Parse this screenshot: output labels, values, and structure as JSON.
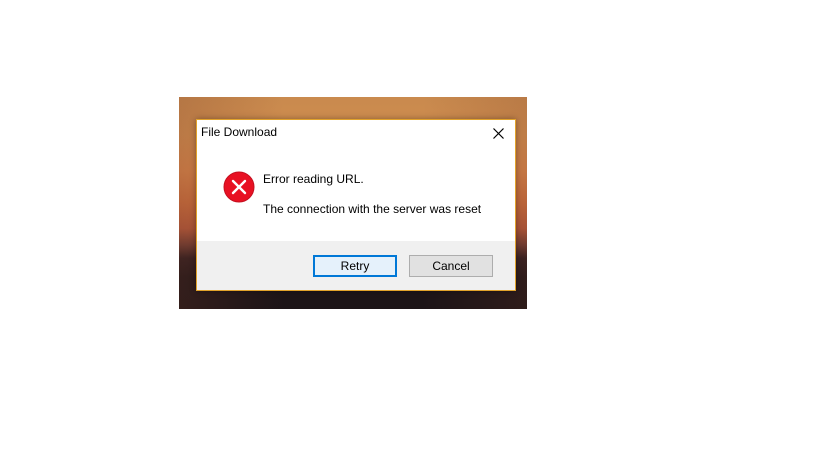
{
  "dialog": {
    "title": "File Download",
    "close_icon": "close-icon",
    "icon": "error-icon",
    "message_primary": "Error reading URL.",
    "message_secondary": "The connection with the server was reset",
    "buttons": {
      "retry_label": "Retry",
      "cancel_label": "Cancel"
    }
  },
  "colors": {
    "dialog_border": "#e2a32b",
    "default_button_border": "#0078d7",
    "error_icon": "#e81123",
    "footer_background": "#f0f0f0"
  }
}
